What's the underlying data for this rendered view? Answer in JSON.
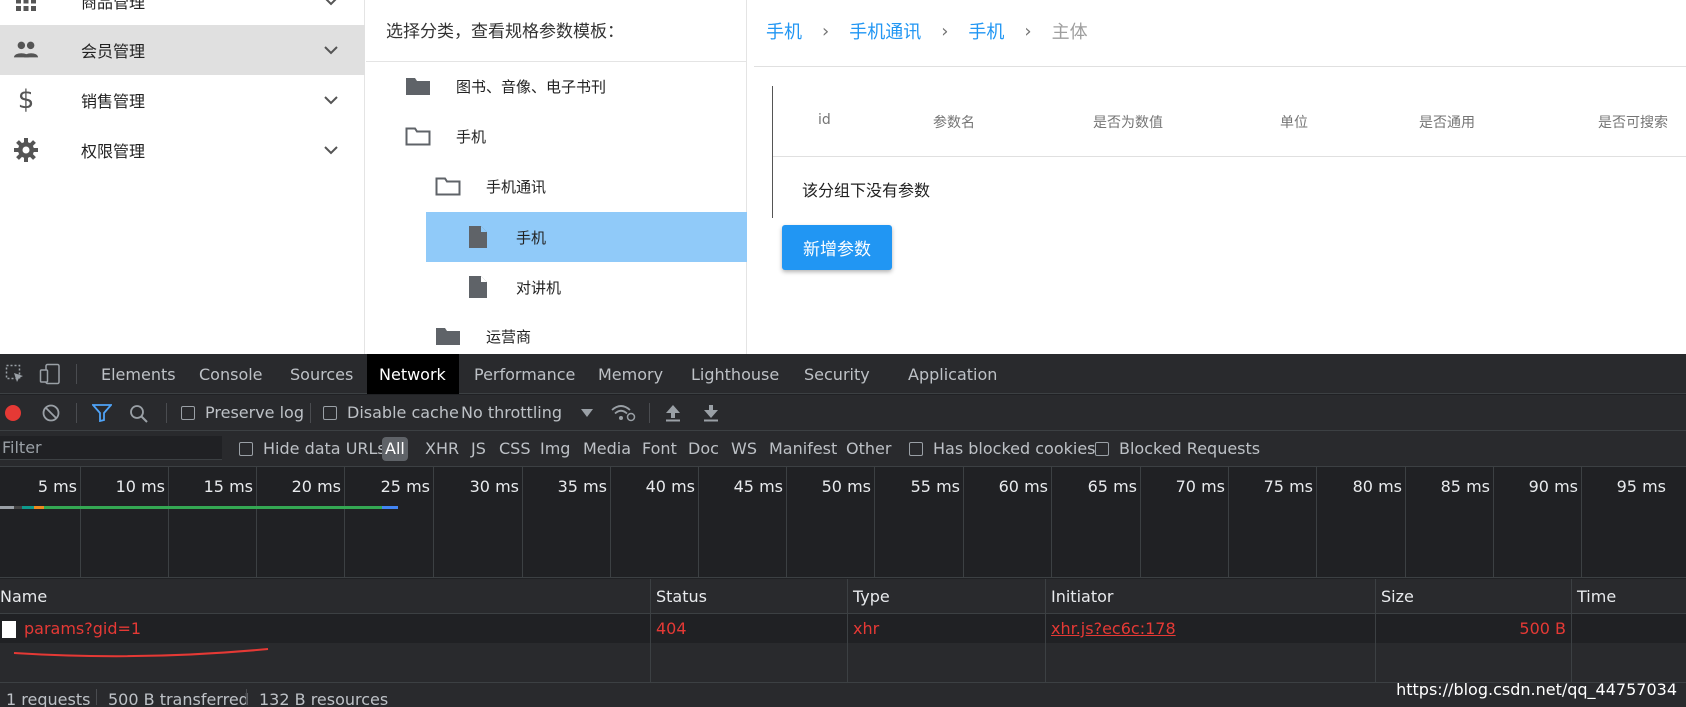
{
  "sidebar": {
    "items": [
      {
        "label": "商品管理",
        "icon": "grid-icon"
      },
      {
        "label": "会员管理",
        "icon": "people-icon",
        "active": true
      },
      {
        "label": "销售管理",
        "icon": "dollar-icon"
      },
      {
        "label": "权限管理",
        "icon": "gear-icon"
      }
    ]
  },
  "tree": {
    "title": "选择分类，查看规格参数模板：",
    "nodes": [
      {
        "label": "图书、音像、电子书刊",
        "icon": "folder-icon"
      },
      {
        "label": "手机",
        "icon": "folder-open-icon"
      },
      {
        "label": "手机通讯",
        "icon": "folder-open-icon"
      },
      {
        "label": "手机",
        "icon": "file-icon",
        "selected": true
      },
      {
        "label": "对讲机",
        "icon": "file-icon"
      },
      {
        "label": "运营商",
        "icon": "folder-icon"
      }
    ]
  },
  "breadcrumb": {
    "items": [
      "手机",
      "手机通讯",
      "手机",
      "主体"
    ],
    "separator": "›"
  },
  "params_table": {
    "columns": [
      "id",
      "参数名",
      "是否为数值",
      "单位",
      "是否通用",
      "是否可搜索"
    ],
    "empty_text": "该分组下没有参数",
    "add_button": "新增参数"
  },
  "devtools": {
    "tabs": [
      "Elements",
      "Console",
      "Sources",
      "Network",
      "Performance",
      "Memory",
      "Lighthouse",
      "Security",
      "Application"
    ],
    "active_tab": "Network",
    "network_toolbar": {
      "preserve_log": "Preserve log",
      "disable_cache": "Disable cache",
      "throttling": "No throttling"
    },
    "filter": {
      "placeholder": "Filter",
      "hide_data_urls": "Hide data URLs",
      "types": [
        "All",
        "XHR",
        "JS",
        "CSS",
        "Img",
        "Media",
        "Font",
        "Doc",
        "WS",
        "Manifest",
        "Other"
      ],
      "has_blocked_cookies": "Has blocked cookies",
      "blocked_requests": "Blocked Requests"
    },
    "timeline_ticks": [
      "5 ms",
      "10 ms",
      "15 ms",
      "20 ms",
      "25 ms",
      "30 ms",
      "35 ms",
      "40 ms",
      "45 ms",
      "50 ms",
      "55 ms",
      "60 ms",
      "65 ms",
      "70 ms",
      "75 ms",
      "80 ms",
      "85 ms",
      "90 ms",
      "95 ms"
    ],
    "table": {
      "columns": [
        "Name",
        "Status",
        "Type",
        "Initiator",
        "Size",
        "Time"
      ],
      "rows": [
        {
          "name": "params?gid=1",
          "status": "404",
          "type": "xhr",
          "initiator": "xhr.js?ec6c:178",
          "size": "500 B",
          "time": ""
        }
      ]
    },
    "status_bar": [
      "1 requests",
      "500 B transferred",
      "132 B resources"
    ]
  },
  "watermark": "https://blog.csdn.net/qq_44757034",
  "colors": {
    "primary": "#2196f3",
    "selected_node": "#90caf9",
    "error_red": "#e53935",
    "devtools_bg": "#202124"
  }
}
